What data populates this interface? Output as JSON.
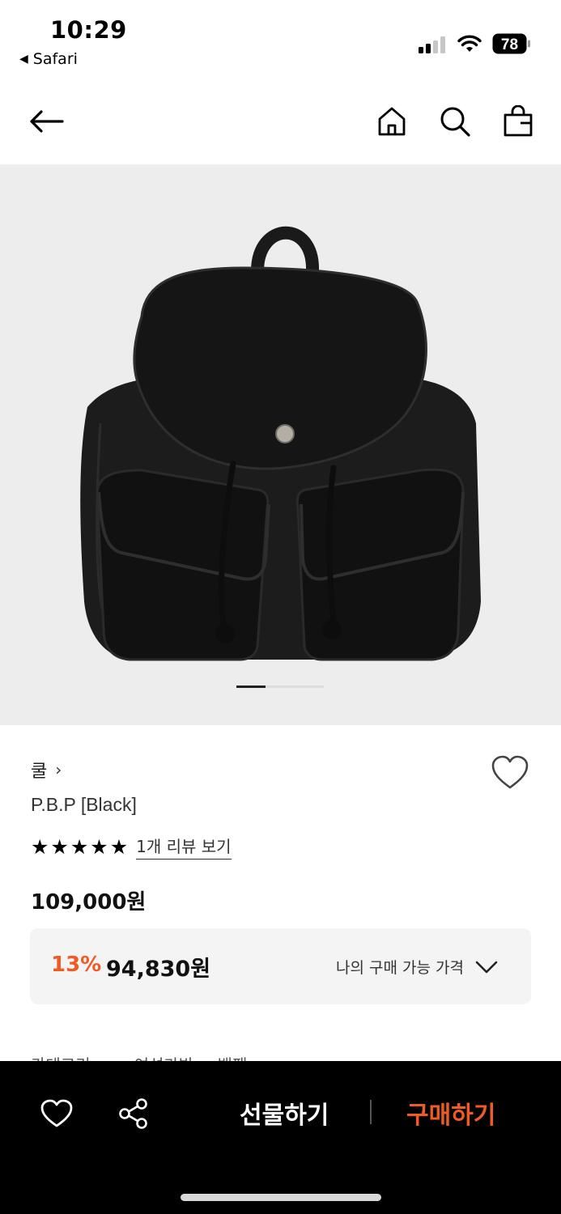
{
  "status_bar": {
    "time": "10:29",
    "back_app": "Safari",
    "battery": "78",
    "icons": [
      "signal-icon",
      "wifi-icon",
      "battery-icon"
    ]
  },
  "nav": {
    "icons": [
      "back-arrow-icon",
      "home-icon",
      "search-icon",
      "shopping-bag-icon"
    ]
  },
  "gallery": {
    "current_index": 1,
    "total": 3,
    "image": "black-backpack-product-photo"
  },
  "product": {
    "brand": "쿨",
    "brand_chevron": "›",
    "name": "P.B.P [Black]",
    "rating": 5,
    "stars": [
      "★",
      "★",
      "★",
      "★",
      "★"
    ],
    "review_link": "1개 리뷰 보기",
    "original_price": "109,000원",
    "discount_rate": "13%",
    "sale_price": "94,830원",
    "my_price_label": "나의 구매 가능 가격"
  },
  "category_peek": {
    "label": "카테고리",
    "path": "여성가방 > 백팩"
  },
  "action_bar": {
    "gift_label": "선물하기",
    "buy_label": "구매하기",
    "icons": [
      "heart-icon",
      "share-icon"
    ]
  },
  "colors": {
    "accent": "#f05a24",
    "action_bar_bg": "#000000",
    "gallery_bg": "#ededed",
    "price_box_bg": "#f4f4f4"
  }
}
